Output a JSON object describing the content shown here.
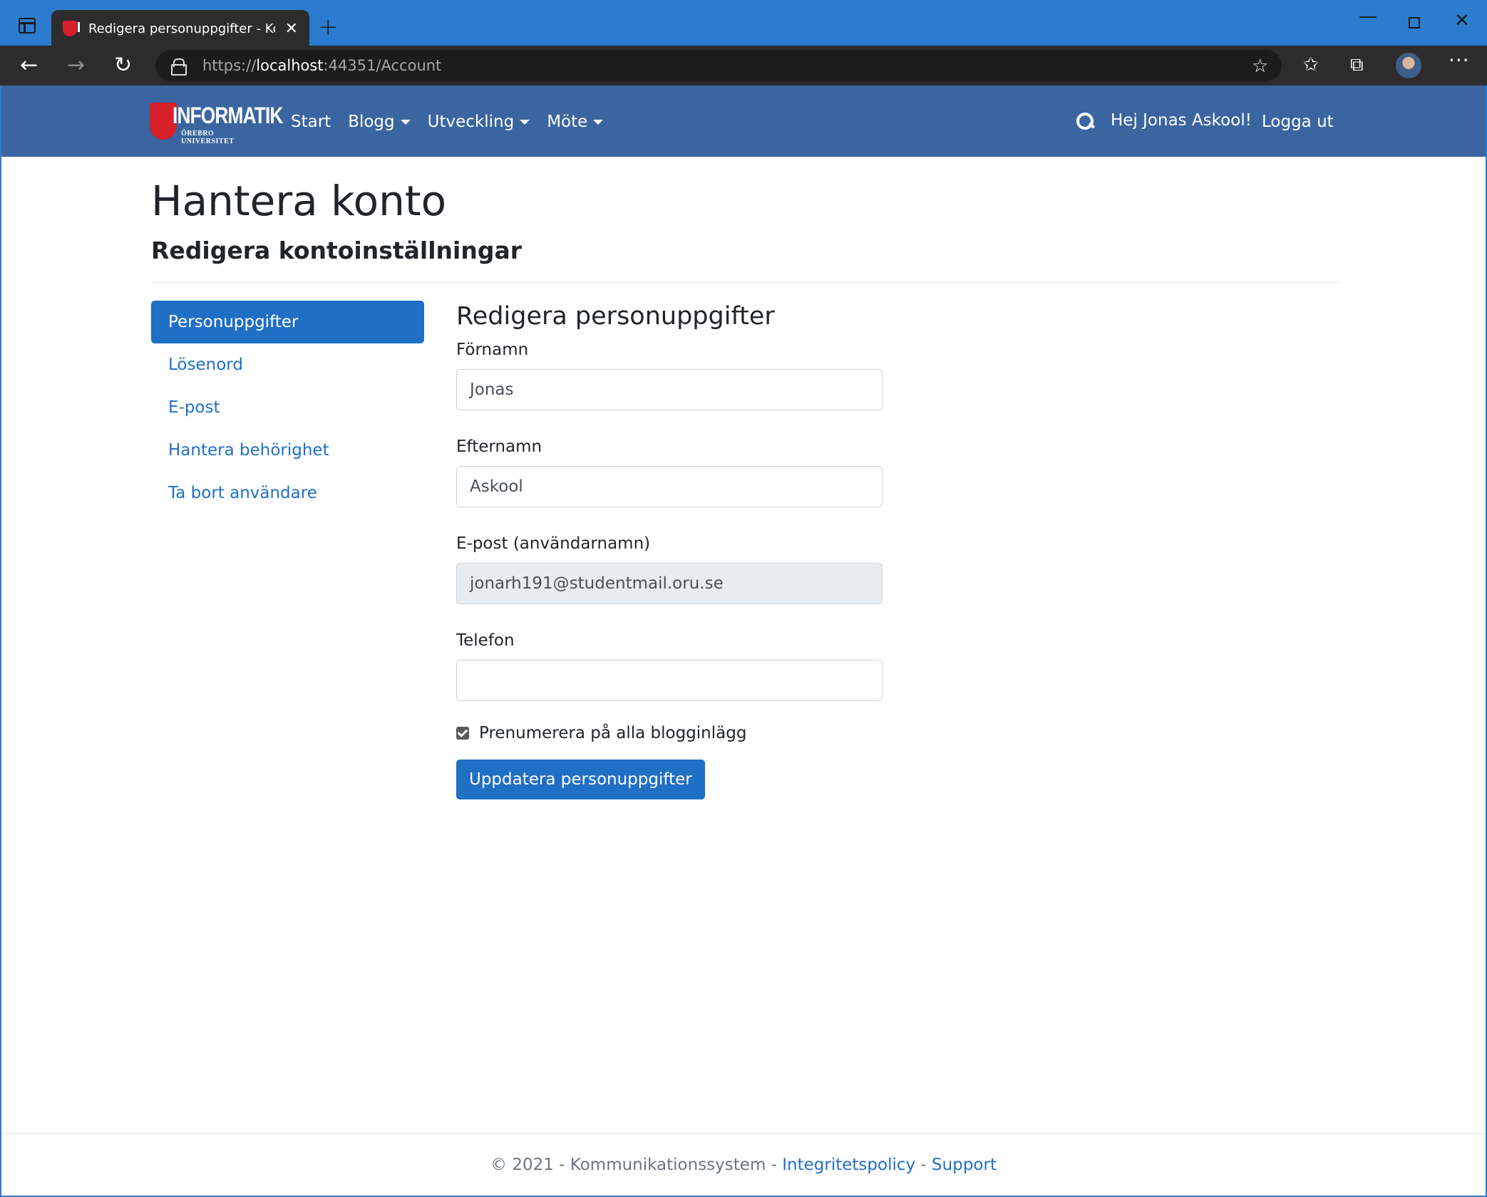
{
  "browser": {
    "tab_title": "Redigera personuppgifter - Kom",
    "tab_close": "✕",
    "new_tab": "+",
    "url_prefix": "https://",
    "url_host": "localhost",
    "url_rest": ":44351/Account",
    "icons": {
      "back": "←",
      "forward": "→",
      "reload": "↻",
      "favorite_add": "☆",
      "favorites": "✩",
      "collections": "⧉",
      "more": "···",
      "minimize": "—",
      "close": "✕"
    }
  },
  "navbar": {
    "logo_text": "INFORMATIK",
    "logo_subtext": "ÖREBRO UNIVERSITET",
    "links": [
      "Start",
      "Blogg",
      "Utveckling",
      "Möte"
    ],
    "greeting": "Hej Jonas Askool!",
    "logout": "Logga ut"
  },
  "page": {
    "title": "Hantera konto",
    "subtitle": "Redigera kontoinställningar"
  },
  "sidenav": {
    "items": [
      {
        "label": "Personuppgifter",
        "active": true
      },
      {
        "label": "Lösenord"
      },
      {
        "label": "E-post"
      },
      {
        "label": "Hantera behörighet"
      },
      {
        "label": "Ta bort användare"
      }
    ]
  },
  "form": {
    "heading": "Redigera personuppgifter",
    "firstname_label": "Förnamn",
    "firstname_value": "Jonas",
    "lastname_label": "Efternamn",
    "lastname_value": "Askool",
    "email_label": "E-post (användarnamn)",
    "email_value": "jonarh191@studentmail.oru.se",
    "phone_label": "Telefon",
    "phone_value": "",
    "subscribe_label": "Prenumerera på alla blogginlägg",
    "subscribe_checked": true,
    "submit_label": "Uppdatera personuppgifter"
  },
  "footer": {
    "copyright": "© 2021 - Kommunikationssystem - ",
    "privacy": "Integritetspolicy",
    "separator": " - ",
    "support": "Support"
  },
  "colors": {
    "titlebar": "#2b7ccf",
    "navbar": "#3a65a0",
    "primary": "#1f6fc5",
    "logo_red": "#d6202a"
  }
}
